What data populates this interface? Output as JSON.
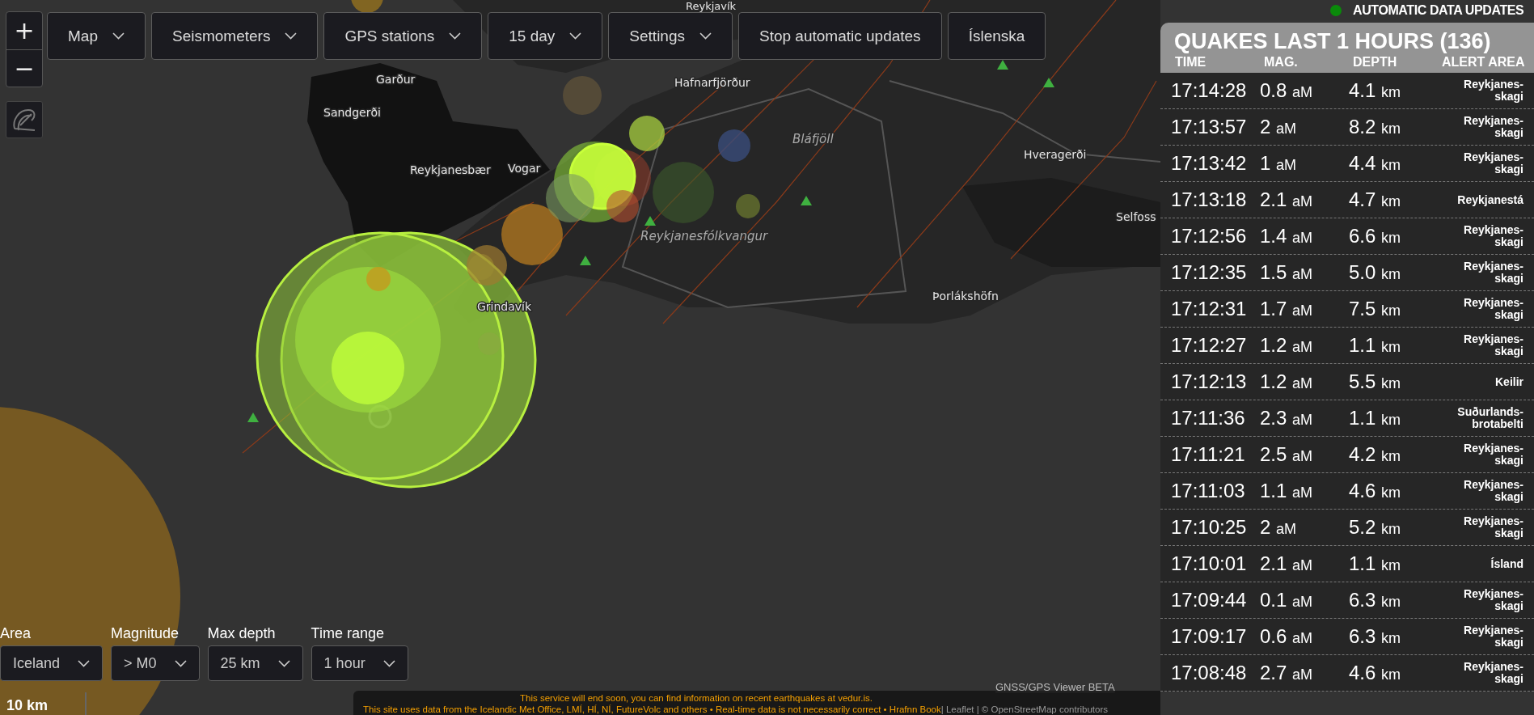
{
  "zoom_controls": [
    "+",
    "−"
  ],
  "toolbar": [
    {
      "label": "Map",
      "kind": "dropdown"
    },
    {
      "label": "Seismometers",
      "kind": "dropdown"
    },
    {
      "label": "GPS stations",
      "kind": "dropdown"
    },
    {
      "label": "15 day",
      "kind": "dropdown"
    },
    {
      "label": "Settings",
      "kind": "dropdown"
    },
    {
      "label": "Stop automatic updates",
      "kind": "button"
    },
    {
      "label": "Íslenska",
      "kind": "button"
    }
  ],
  "map_labels": [
    {
      "text": "Reykjavík",
      "kind": "town"
    },
    {
      "text": "Garður",
      "kind": "town"
    },
    {
      "text": "Sandgerði",
      "kind": "town"
    },
    {
      "text": "Hafnarfjörður",
      "kind": "town"
    },
    {
      "text": "Reykjanesbær",
      "kind": "town"
    },
    {
      "text": "Vogar",
      "kind": "town"
    },
    {
      "text": "Bláfjöll",
      "kind": "area"
    },
    {
      "text": "Reykjanesfólkvangur",
      "kind": "area"
    },
    {
      "text": "Hveragerði",
      "kind": "town"
    },
    {
      "text": "Selfoss",
      "kind": "town"
    },
    {
      "text": "Þorlákshöfn",
      "kind": "town"
    },
    {
      "text": "Grindavík",
      "kind": "town"
    }
  ],
  "status": {
    "label": "AUTOMATIC DATA UPDATES",
    "on": true
  },
  "quake_list": {
    "title": "QUAKES LAST 1 HOURS (136)",
    "columns": [
      "TIME",
      "MAG.",
      "DEPTH",
      "ALERT AREA"
    ],
    "rows": [
      {
        "time": "17:14:28",
        "magnitude": "0.8",
        "magnitude_unit": "aM",
        "depth": "4.1",
        "depth_unit": "km",
        "alert_area": "Reykjanes-skagi"
      },
      {
        "time": "17:13:57",
        "magnitude": "2",
        "magnitude_unit": "aM",
        "depth": "8.2",
        "depth_unit": "km",
        "alert_area": "Reykjanes-skagi"
      },
      {
        "time": "17:13:42",
        "magnitude": "1",
        "magnitude_unit": "aM",
        "depth": "4.4",
        "depth_unit": "km",
        "alert_area": "Reykjanes-skagi"
      },
      {
        "time": "17:13:18",
        "magnitude": "2.1",
        "magnitude_unit": "aM",
        "depth": "4.7",
        "depth_unit": "km",
        "alert_area": "Reykjanestá"
      },
      {
        "time": "17:12:56",
        "magnitude": "1.4",
        "magnitude_unit": "aM",
        "depth": "6.6",
        "depth_unit": "km",
        "alert_area": "Reykjanes-skagi"
      },
      {
        "time": "17:12:35",
        "magnitude": "1.5",
        "magnitude_unit": "aM",
        "depth": "5.0",
        "depth_unit": "km",
        "alert_area": "Reykjanes-skagi"
      },
      {
        "time": "17:12:31",
        "magnitude": "1.7",
        "magnitude_unit": "aM",
        "depth": "7.5",
        "depth_unit": "km",
        "alert_area": "Reykjanes-skagi"
      },
      {
        "time": "17:12:27",
        "magnitude": "1.2",
        "magnitude_unit": "aM",
        "depth": "1.1",
        "depth_unit": "km",
        "alert_area": "Reykjanes-skagi"
      },
      {
        "time": "17:12:13",
        "magnitude": "1.2",
        "magnitude_unit": "aM",
        "depth": "5.5",
        "depth_unit": "km",
        "alert_area": "Keilir"
      },
      {
        "time": "17:11:36",
        "magnitude": "2.3",
        "magnitude_unit": "aM",
        "depth": "1.1",
        "depth_unit": "km",
        "alert_area": "Suðurlands-brotabelti"
      },
      {
        "time": "17:11:21",
        "magnitude": "2.5",
        "magnitude_unit": "aM",
        "depth": "4.2",
        "depth_unit": "km",
        "alert_area": "Reykjanes-skagi"
      },
      {
        "time": "17:11:03",
        "magnitude": "1.1",
        "magnitude_unit": "aM",
        "depth": "4.6",
        "depth_unit": "km",
        "alert_area": "Reykjanes-skagi"
      },
      {
        "time": "17:10:25",
        "magnitude": "2",
        "magnitude_unit": "aM",
        "depth": "5.2",
        "depth_unit": "km",
        "alert_area": "Reykjanes-skagi"
      },
      {
        "time": "17:10:01",
        "magnitude": "2.1",
        "magnitude_unit": "aM",
        "depth": "1.1",
        "depth_unit": "km",
        "alert_area": "Ísland"
      },
      {
        "time": "17:09:44",
        "magnitude": "0.1",
        "magnitude_unit": "aM",
        "depth": "6.3",
        "depth_unit": "km",
        "alert_area": "Reykjanes-skagi"
      },
      {
        "time": "17:09:17",
        "magnitude": "0.6",
        "magnitude_unit": "aM",
        "depth": "6.3",
        "depth_unit": "km",
        "alert_area": "Reykjanes-skagi"
      },
      {
        "time": "17:08:48",
        "magnitude": "2.7",
        "magnitude_unit": "aM",
        "depth": "4.6",
        "depth_unit": "km",
        "alert_area": "Reykjanes-skagi"
      }
    ]
  },
  "filters": [
    {
      "label": "Area",
      "value": "Iceland"
    },
    {
      "label": "Magnitude",
      "value": "> M0"
    },
    {
      "label": "Max depth",
      "value": "25 km"
    },
    {
      "label": "Time range",
      "value": "1 hour"
    }
  ],
  "scale": "10 km",
  "attribution": {
    "link": "GNSS/GPS Viewer BETA",
    "notice": "This service will end soon, you can find information on recent earthquakes at vedur.is.",
    "credits": "This site uses data from the Icelandic Met Office, LMÍ, HÍ, NÍ, FutureVolc and others • Real-time data is not necessarily correct • Hrafnn Book",
    "map_credit": "| Leaflet | © OpenStreetMap contributors"
  }
}
